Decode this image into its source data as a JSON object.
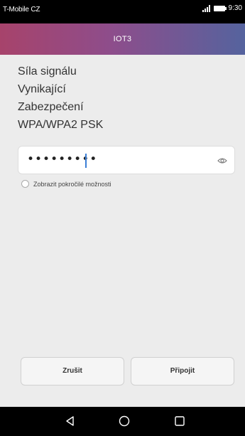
{
  "status_bar": {
    "carrier": "T-Mobile CZ",
    "time": "9:30",
    "icons": [
      "signal-icon",
      "battery-icon"
    ]
  },
  "header": {
    "title": "IOT3"
  },
  "network_info": {
    "signal_label": "Síla signálu",
    "signal_value": "Vynikající",
    "security_label": "Zabezpečení",
    "security_value": "WPA/WPA2 PSK"
  },
  "password": {
    "value": "•••••••••",
    "toggle_icon": "eye-icon"
  },
  "advanced_option": {
    "label": "Zobrazit pokročilé možnosti",
    "checked": false
  },
  "buttons": {
    "cancel": "Zrušit",
    "connect": "Připojit"
  },
  "nav_bar": {
    "icons": [
      "back-icon",
      "home-icon",
      "recents-icon"
    ]
  }
}
